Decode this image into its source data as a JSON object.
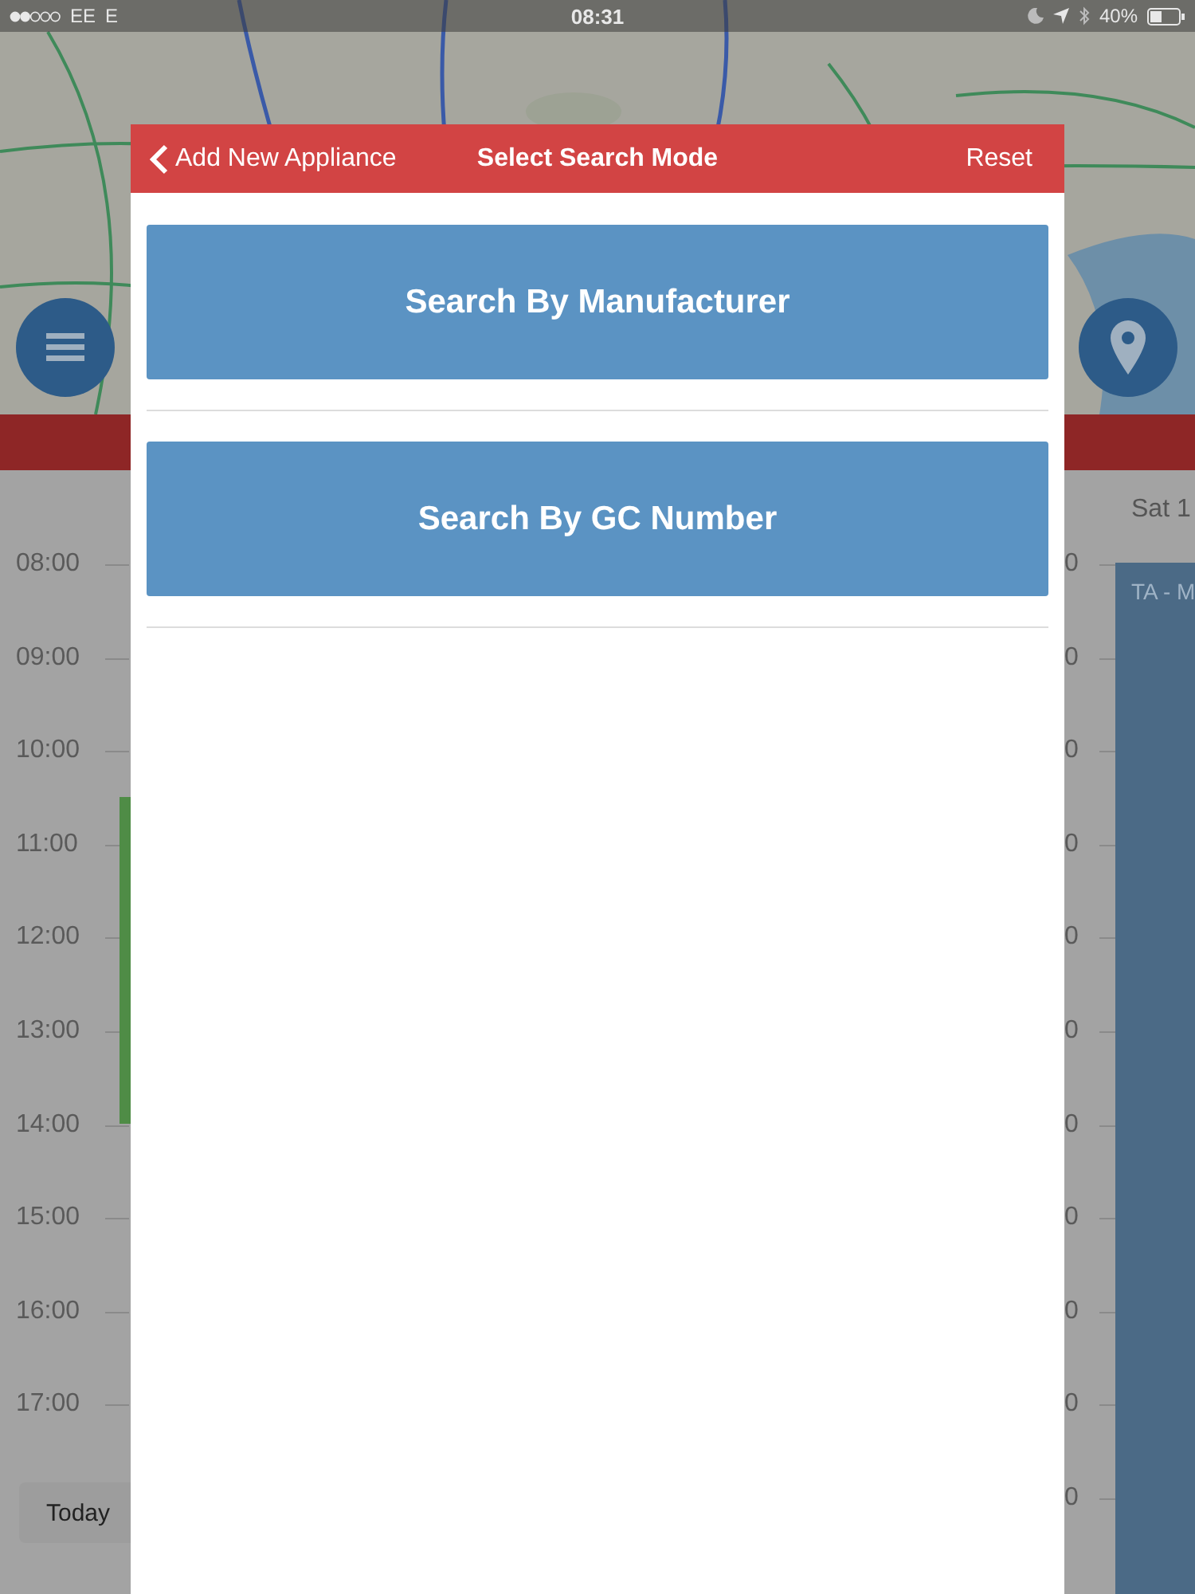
{
  "status_bar": {
    "carrier": "EE",
    "network": "E",
    "time": "08:31",
    "battery": "40%"
  },
  "calendar": {
    "day_header": "Sat 1",
    "time_labels": [
      "08:00",
      "09:00",
      "10:00",
      "11:00",
      "12:00",
      "13:00",
      "14:00",
      "15:00",
      "16:00",
      "17:00"
    ],
    "right_time_labels": [
      "0",
      "0",
      "0",
      "0",
      "0",
      "0",
      "0",
      "0",
      "0",
      "0",
      "0"
    ],
    "events": [
      {
        "color": "#4f8c46"
      },
      {
        "title": "TA - M",
        "color": "#4b6a86"
      }
    ]
  },
  "today_button": "Today",
  "modal": {
    "back_label": "Add New Appliance",
    "title": "Select Search Mode",
    "action": "Reset",
    "options": [
      "Search By Manufacturer",
      "Search By GC Number"
    ]
  }
}
